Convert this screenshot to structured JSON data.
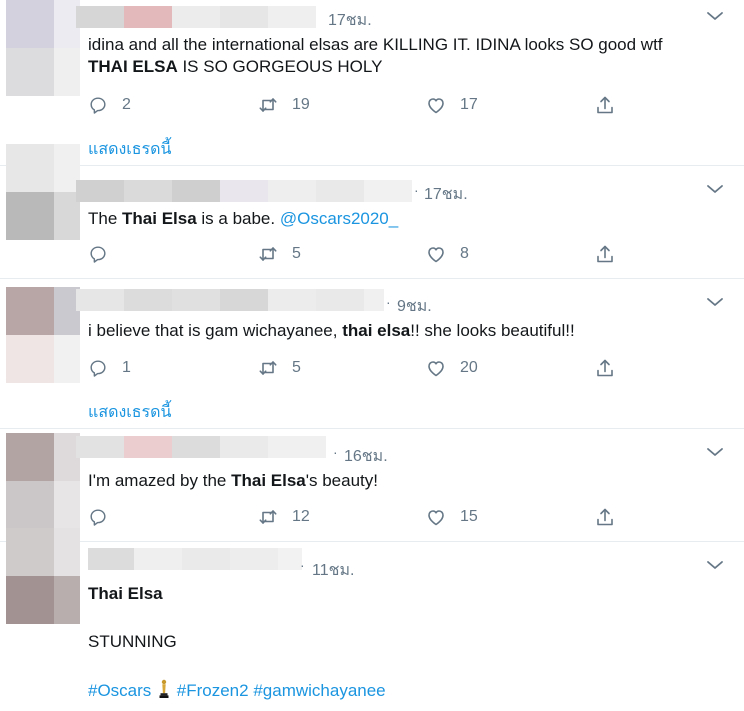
{
  "icons": {
    "reply": "speech-bubble-icon",
    "retweet": "retweet-arrows-icon",
    "like": "heart-icon",
    "share": "share-upload-icon",
    "caret": "chevron-down-icon",
    "trophy": "oscar-trophy-icon"
  },
  "colors": {
    "link": "#1b95e0",
    "muted": "#657786",
    "divider": "#e6ecf0"
  },
  "tweets": [
    {
      "time": "17ชม.",
      "line1": "idina and all the international elsas are KILLING IT. IDINA looks SO good wtf",
      "line2_bold": "THAI ELSA",
      "line2_rest": " IS SO GORGEOUS HOLY",
      "replies": "2",
      "retweets": "19",
      "likes": "17",
      "thread_link": "แสดงเธรดนี้"
    },
    {
      "time": "17ชม.",
      "text_pre": "The ",
      "text_bold": "Thai Elsa",
      "text_mid": " is a babe. ",
      "mention": "@Oscars2020_",
      "replies": "",
      "retweets": "5",
      "likes": "8"
    },
    {
      "time": "9ชม.",
      "text_pre": "i believe that is gam wichayanee, ",
      "text_bold": "thai elsa",
      "text_post": "!! she looks beautiful!!",
      "replies": "1",
      "retweets": "5",
      "likes": "20",
      "thread_link": "แสดงเธรดนี้"
    },
    {
      "time": "16ชม.",
      "text_pre": "I'm amazed by the ",
      "text_bold": "Thai Elsa",
      "text_post": "'s beauty!",
      "replies": "",
      "retweets": "12",
      "likes": "15"
    },
    {
      "time": "11ชม.",
      "title_bold": "Thai Elsa",
      "body": "STUNNING",
      "tag1": "#Oscars",
      "tag2": "#Frozen2",
      "tag3": "#gamwichayanee"
    }
  ]
}
